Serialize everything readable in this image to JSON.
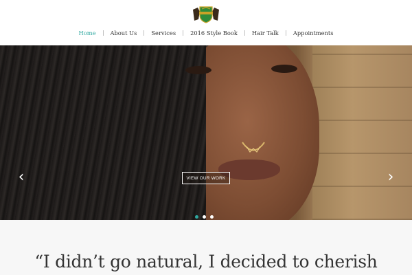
{
  "logo": {
    "icon": "crest-logo-icon"
  },
  "nav": {
    "items": [
      {
        "label": "Home",
        "active": true
      },
      {
        "label": "About Us",
        "active": false
      },
      {
        "label": "Services",
        "active": false
      },
      {
        "label": "2016 Style Book",
        "active": false
      },
      {
        "label": "Hair Talk",
        "active": false
      },
      {
        "label": "Appointments",
        "active": false
      }
    ],
    "accent_color": "#2fa8a0"
  },
  "hero": {
    "cta_label": "VIEW OUR WORK",
    "prev_arrow": "‹",
    "next_arrow": "›",
    "slide_count": 3,
    "active_slide": 1
  },
  "quote": {
    "text": "“I didn’t go natural, I decided to cherish"
  }
}
